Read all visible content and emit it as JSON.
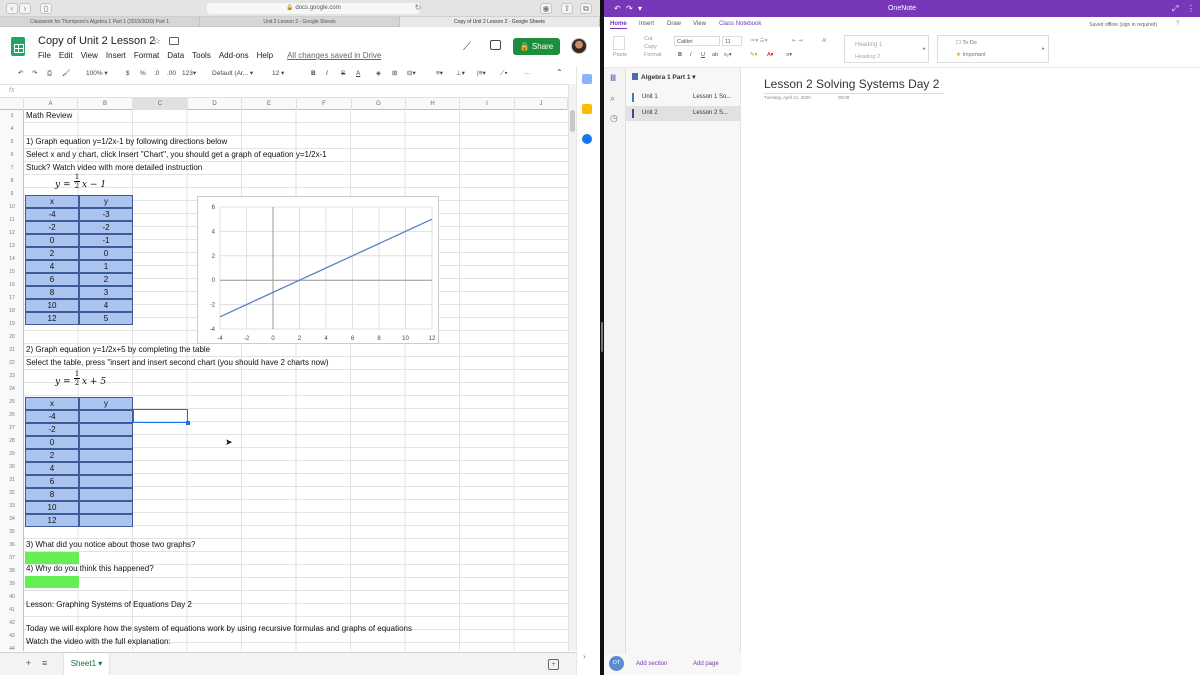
{
  "safari": {
    "url": "docs.google.com",
    "tabs": [
      "Classwork for Thompson's Algebra 1 Part 1 (2019/2020) Part 1",
      "Unit 2 Lesson 2 - Google Sheets",
      "Copy of Unit 2 Lesson 2 - Google Sheets"
    ]
  },
  "sheets": {
    "doc_title": "Copy of Unit 2 Lesson 2",
    "menu": [
      "File",
      "Edit",
      "View",
      "Insert",
      "Format",
      "Data",
      "Tools",
      "Add-ons",
      "Help"
    ],
    "saved_status": "All changes saved in Drive",
    "share_label": "Share",
    "toolbar": {
      "zoom": "100%",
      "currency": "$",
      "percent": "%",
      "dec_less": ".0",
      "dec_more": ".00",
      "format_more": "123",
      "font": "Default (Ar...",
      "font_size": "12",
      "bold": "B",
      "italic": "I",
      "strike": "S",
      "text_color": "A",
      "more": "···"
    },
    "fx": "fx",
    "columns": [
      "A",
      "B",
      "C",
      "D",
      "E",
      "F",
      "G",
      "H",
      "I",
      "J"
    ],
    "row_numbers": [
      "3",
      "4",
      "5",
      "6",
      "7",
      "8",
      "9",
      "10",
      "11",
      "12",
      "13",
      "14",
      "15",
      "16",
      "17",
      "18",
      "19",
      "20",
      "21",
      "22",
      "23",
      "24",
      "25",
      "26",
      "27",
      "28",
      "29",
      "30",
      "31",
      "32",
      "33",
      "34",
      "35",
      "36",
      "37",
      "38",
      "39",
      "40",
      "41",
      "42",
      "43",
      "44",
      "45"
    ],
    "lines": {
      "math_review": "Math Review",
      "q1": "1) Graph equation y=1/2x-1 by following directions below",
      "q1_select": "Select x and y chart, click Insert \"Chart\", you should get a graph of equation y=1/2x-1",
      "q1_stuck": "Stuck? Watch video with more detailed instruction",
      "q2": "2) Graph equation y=1/2x+5 by completing the table",
      "q2_select": "Select the table, press \"insert and insert second chart (you should have 2 charts now)",
      "q3": "3) What did you notice about those two graphs?",
      "q4": "4) Why do you think this happened?",
      "lesson": "Lesson: Graphing Systems of Equations Day 2",
      "today": "Today we will explore how the system of equations work by using recursive formulas and graphs of equations",
      "watch": "Watch the video with the full explanation:"
    },
    "eq1": {
      "lhs": "y =",
      "num": "1",
      "den": "2",
      "rhs": "x − 1"
    },
    "eq2": {
      "lhs": "y =",
      "num": "1",
      "den": "2",
      "rhs": "x + 5"
    },
    "table1": {
      "headers": [
        "x",
        "y"
      ],
      "x": [
        "-4",
        "-2",
        "0",
        "2",
        "4",
        "6",
        "8",
        "10",
        "12"
      ],
      "y": [
        "-3",
        "-2",
        "-1",
        "0",
        "1",
        "2",
        "3",
        "4",
        "5"
      ]
    },
    "table2": {
      "headers": [
        "x",
        "y"
      ],
      "x": [
        "-4",
        "-2",
        "0",
        "2",
        "4",
        "6",
        "8",
        "10",
        "12"
      ]
    },
    "sheet_tab": "Sheet1"
  },
  "chart_data": {
    "type": "line",
    "x": [
      -4,
      -2,
      0,
      2,
      4,
      6,
      8,
      10,
      12
    ],
    "series": [
      {
        "values": [
          -3,
          -2,
          -1,
          0,
          1,
          2,
          3,
          4,
          5
        ]
      }
    ],
    "xlim": [
      -4,
      12
    ],
    "ylim": [
      -4,
      6
    ],
    "xticks": [
      "-4",
      "-2",
      "0",
      "2",
      "4",
      "6",
      "8",
      "10",
      "12"
    ],
    "yticks": [
      "6",
      "4",
      "2",
      "0",
      "-2",
      "-4"
    ],
    "grid": true,
    "line_color": "#5b84c4"
  },
  "onenote": {
    "app_title": "OneNote",
    "tabs": [
      "Home",
      "Insert",
      "Draw",
      "View",
      "Class Notebook"
    ],
    "status": "Saved offline (sign in required)",
    "ribbon": {
      "paste": "Paste",
      "cut": "Cut",
      "copy": "Copy",
      "format": "Format",
      "font": "Calibri",
      "size": "11",
      "heading1": "Heading 1",
      "heading2": "Heading 2",
      "todo": "To Do",
      "important": "Important"
    },
    "notebook": "Algebra 1 Part 1",
    "sections": [
      {
        "name": "Unit 1",
        "page": "Lesson 1 So...",
        "color": "#3a78c9"
      },
      {
        "name": "Unit 2",
        "page": "Lesson 2 S...",
        "color": "#2f4f8f"
      }
    ],
    "page": {
      "title": "Lesson 2 Solving Systems Day 2",
      "date": "Tuesday, April 21, 2020",
      "time": "08:08"
    },
    "initials": "OT",
    "add_section": "Add section",
    "add_page": "Add page"
  }
}
